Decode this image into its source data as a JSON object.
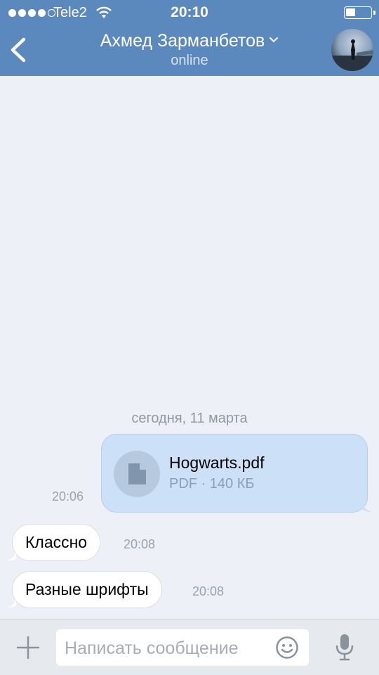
{
  "status_bar": {
    "carrier": "Tele2",
    "time": "20:10"
  },
  "header": {
    "contact_name": "Ахмед Зарманбетов",
    "presence": "online"
  },
  "chat": {
    "date_separator": "сегодня, 11 марта",
    "messages": [
      {
        "type": "file",
        "direction": "outgoing",
        "file_name": "Hogwarts.pdf",
        "file_meta": "PDF · 140 КБ",
        "time": "20:06"
      },
      {
        "type": "text",
        "direction": "incoming",
        "text": "Классно",
        "time": "20:08"
      },
      {
        "type": "text",
        "direction": "incoming",
        "text": "Разные шрифты",
        "time": "20:08"
      }
    ]
  },
  "composer": {
    "placeholder": "Написать сообщение"
  },
  "icons": {
    "back": "chevron-left-icon",
    "menu": "chevron-down-icon",
    "file": "document-icon",
    "attach": "plus-icon",
    "emoji": "smile-icon",
    "voice": "microphone-icon"
  },
  "colors": {
    "header_bg": "#5b88bd",
    "outgoing_bubble": "#cce0f7",
    "incoming_bubble": "#ffffff",
    "chat_bg": "#edf1f7"
  }
}
